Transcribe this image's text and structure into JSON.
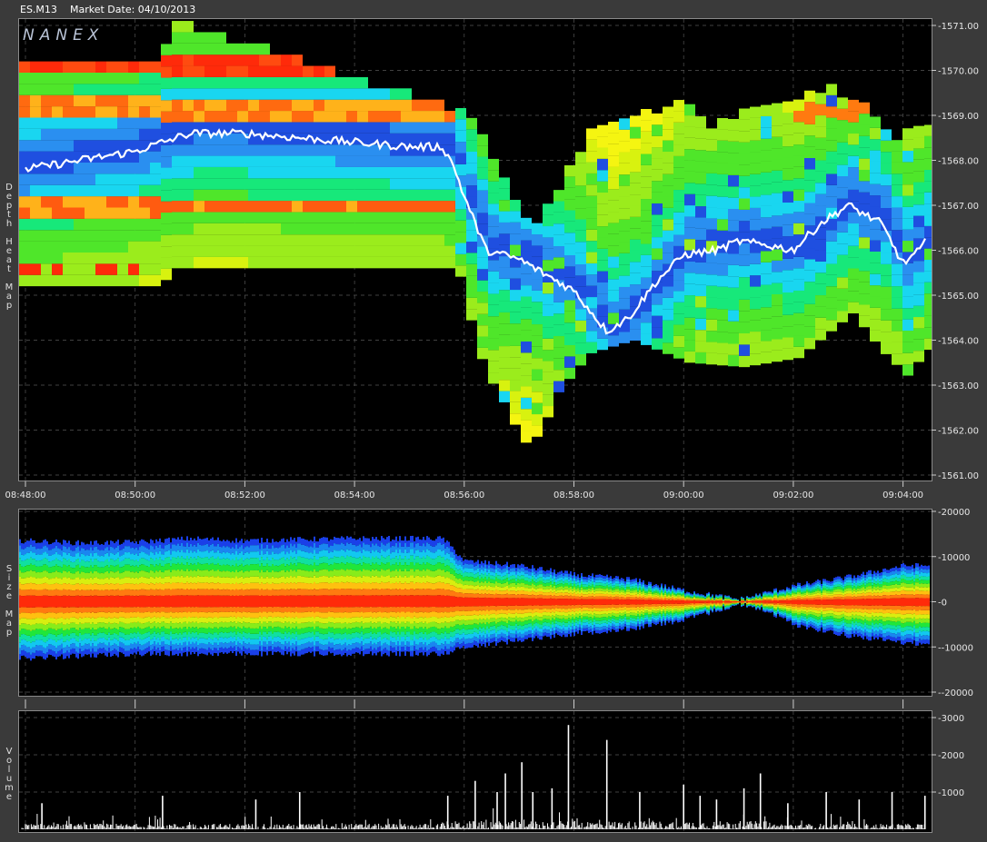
{
  "header": {
    "symbol": "ES.M13",
    "market_date": "Market Date: 04/10/2013"
  },
  "logo": "NANEX",
  "panels": {
    "depth": {
      "label_letters": [
        "D",
        "e",
        "p",
        "t",
        "h",
        "",
        "H",
        "e",
        "a",
        "t",
        "",
        "M",
        "a",
        "p"
      ]
    },
    "size": {
      "label_letters": [
        "S",
        "i",
        "z",
        "e",
        "",
        "M",
        "a",
        "p"
      ]
    },
    "volume": {
      "label_letters": [
        "V",
        "o",
        "l",
        "u",
        "m",
        "e"
      ]
    }
  },
  "chart_data": [
    {
      "type": "heatmap",
      "name": "Depth Heat Map",
      "x_ticks": [
        "08:48:00",
        "08:50:00",
        "08:52:00",
        "08:54:00",
        "08:56:00",
        "08:58:00",
        "09:00:00",
        "09:02:00",
        "09:04:00"
      ],
      "y_ticks": [
        "1571.00",
        "1570.00",
        "1569.00",
        "1568.00",
        "1567.00",
        "1566.00",
        "1565.00",
        "1564.00",
        "1563.00",
        "1562.00",
        "1561.00"
      ],
      "ylim": [
        1561,
        1571
      ],
      "xlim_minutes": [
        0,
        16.7
      ],
      "trade_price": {
        "minutes": [
          0,
          1,
          2,
          2.5,
          3,
          4,
          5,
          6,
          7,
          7.6,
          7.8,
          8,
          8.4,
          9,
          10,
          10.6,
          11,
          11.5,
          12,
          12.6,
          13,
          13.6,
          14,
          14.5,
          15,
          15.6,
          16,
          16.3,
          16.6
        ],
        "price": [
          1567.8,
          1568.0,
          1568.2,
          1568.4,
          1568.6,
          1568.6,
          1568.5,
          1568.4,
          1568.3,
          1568.3,
          1567.9,
          1567.2,
          1566.0,
          1565.8,
          1565.1,
          1564.2,
          1564.5,
          1565.3,
          1565.9,
          1566.0,
          1566.2,
          1566.1,
          1566.0,
          1566.6,
          1567.0,
          1566.6,
          1565.7,
          1566.0,
          1566.5
        ]
      },
      "upper_edge": {
        "minutes": [
          0,
          2.4,
          2.6,
          7.8,
          8.2,
          8.6,
          9.2,
          9.6,
          10.2,
          11,
          12,
          12.3,
          13,
          14,
          14.5,
          15,
          15.8,
          16,
          16.6
        ],
        "price": [
          1570.0,
          1570.0,
          1571.0,
          1569.0,
          1568.5,
          1567.5,
          1566.3,
          1567.2,
          1568.5,
          1568.9,
          1569.2,
          1568.6,
          1569.0,
          1569.2,
          1569.5,
          1569.3,
          1568.3,
          1568.5,
          1568.9
        ]
      },
      "lower_edge": {
        "minutes": [
          0,
          2.4,
          2.6,
          7.8,
          8.0,
          8.3,
          8.6,
          9.0,
          9.3,
          9.6,
          10.2,
          11,
          12,
          13,
          14,
          15,
          15.5,
          16,
          16.3,
          16.6
        ],
        "price": [
          1565.2,
          1565.2,
          1565.6,
          1565.6,
          1564.6,
          1563.3,
          1562.7,
          1561.7,
          1561.9,
          1562.8,
          1563.7,
          1564.0,
          1563.5,
          1563.4,
          1563.6,
          1564.6,
          1563.8,
          1563.2,
          1563.7,
          1564.0
        ]
      }
    },
    {
      "type": "area",
      "name": "Size Map",
      "y_ticks": [
        "20000",
        "10000",
        "0",
        "-10000",
        "-20000"
      ],
      "ylim": [
        -20000,
        20000
      ],
      "upper_bound": {
        "minutes": [
          0,
          1,
          2,
          3,
          4,
          5,
          6,
          7.6,
          8,
          9,
          10,
          11,
          12,
          13,
          13.5,
          14,
          15,
          16,
          16.6
        ],
        "value": [
          13500,
          13000,
          13200,
          14000,
          13500,
          13800,
          14000,
          14000,
          9000,
          8000,
          6000,
          5000,
          2500,
          500,
          2000,
          3500,
          5500,
          8000,
          8000
        ]
      },
      "lower_bound": {
        "minutes": [
          0,
          1,
          2,
          3,
          4,
          5,
          6,
          7.6,
          8,
          9,
          10,
          11,
          12,
          13,
          13.5,
          14,
          15,
          16,
          16.6
        ],
        "value": [
          -12500,
          -12000,
          -11500,
          -11500,
          -11500,
          -11500,
          -11500,
          -11500,
          -10000,
          -8500,
          -7000,
          -6000,
          -4000,
          -500,
          -2000,
          -5000,
          -7500,
          -9000,
          -9500
        ]
      }
    },
    {
      "type": "bar",
      "name": "Volume",
      "y_ticks": [
        "3000",
        "2000",
        "1000"
      ],
      "ylim": [
        0,
        3000
      ],
      "spikes": {
        "minutes": [
          0.3,
          2.5,
          4.2,
          5.0,
          7.7,
          8.2,
          8.6,
          8.75,
          9.05,
          9.25,
          9.6,
          9.9,
          10.6,
          11.2,
          12.0,
          12.3,
          12.6,
          13.1,
          13.4,
          13.9,
          14.6,
          15.2,
          15.8,
          16.4
        ],
        "value": [
          700,
          900,
          800,
          1000,
          900,
          1300,
          1000,
          1500,
          1800,
          1000,
          1100,
          2800,
          2400,
          1000,
          1200,
          900,
          800,
          1100,
          1500,
          700,
          1000,
          800,
          1000,
          900
        ]
      }
    }
  ]
}
